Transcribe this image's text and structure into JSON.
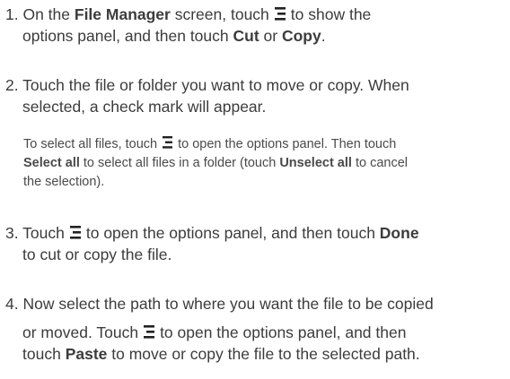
{
  "icons": {
    "menu": "options-menu-icon"
  },
  "steps": [
    {
      "number": "1.",
      "l1_a": " On the ",
      "l1_b": "File Manager",
      "l1_c": " screen, touch",
      "l1_d": "to show the",
      "l2_a": "options panel, and then touch ",
      "l2_b": "Cut",
      "l2_c": " or ",
      "l2_d": "Copy",
      "l2_e": "."
    },
    {
      "number": "2.",
      "l1": " Touch the file or folder you want to move or copy. When",
      "l2": "selected, a check mark will appear."
    },
    {
      "number": "3.",
      "l1_a": " Touch",
      "l1_b": "to open the options panel, and then touch ",
      "l1_c": "Done",
      "l2": "to cut or copy the file."
    },
    {
      "number": "4.",
      "l1": " Now select the path to where you want the file to be copied",
      "l2_a": "or moved. Touch",
      "l2_b": "to open the options panel, and then",
      "l3_a": "touch ",
      "l3_b": "Paste",
      "l3_c": " to move or copy the file to the selected path."
    }
  ],
  "note": {
    "l1_a": "To select all files, touch",
    "l1_b": "to open the options panel. Then touch",
    "l2_a": "Select all",
    "l2_b": " to select all files in a folder (touch ",
    "l2_c": "Unselect all",
    "l2_d": " to cancel",
    "l3": "the selection)."
  }
}
